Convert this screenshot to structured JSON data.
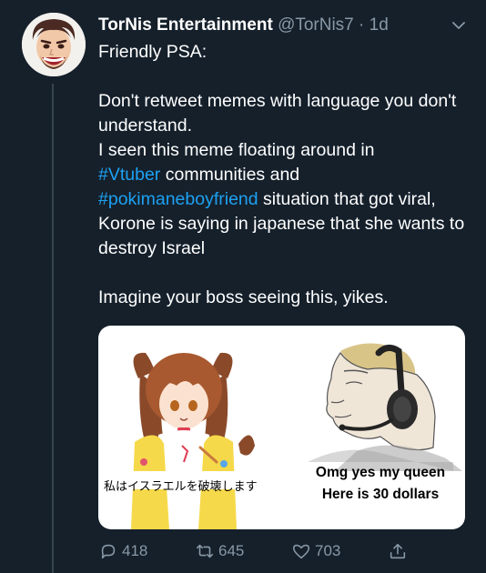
{
  "tweet": {
    "author_name": "TorNis Entertainment",
    "author_handle": "@TorNis7",
    "separator": "·",
    "time_ago": "1d",
    "body": {
      "line1": "Friendly PSA:",
      "para2_a": "Don't retweet memes with language you don't understand.",
      "para2_b": "I seen this meme floating around in",
      "hashtag1": "#Vtuber",
      "para2_c": "communities and",
      "hashtag2": "#pokimaneboyfriend",
      "para2_d": "situation that got viral, Korone is saying in japanese that she wants to destroy Israel",
      "para3": "Imagine your boss seeing this, yikes."
    },
    "media": {
      "caption_left": "私はイスラエルを破壊します",
      "caption_right_line1": "Omg yes my queen",
      "caption_right_line2": "Here is 30 dollars"
    },
    "actions": {
      "replies": "418",
      "retweets": "645",
      "likes": "703"
    }
  },
  "colors": {
    "background": "#15202b",
    "link": "#1da1f2",
    "secondary_text": "#8899a6"
  },
  "icons": [
    "chevron-down-icon",
    "reply-icon",
    "retweet-icon",
    "like-icon",
    "share-icon"
  ]
}
